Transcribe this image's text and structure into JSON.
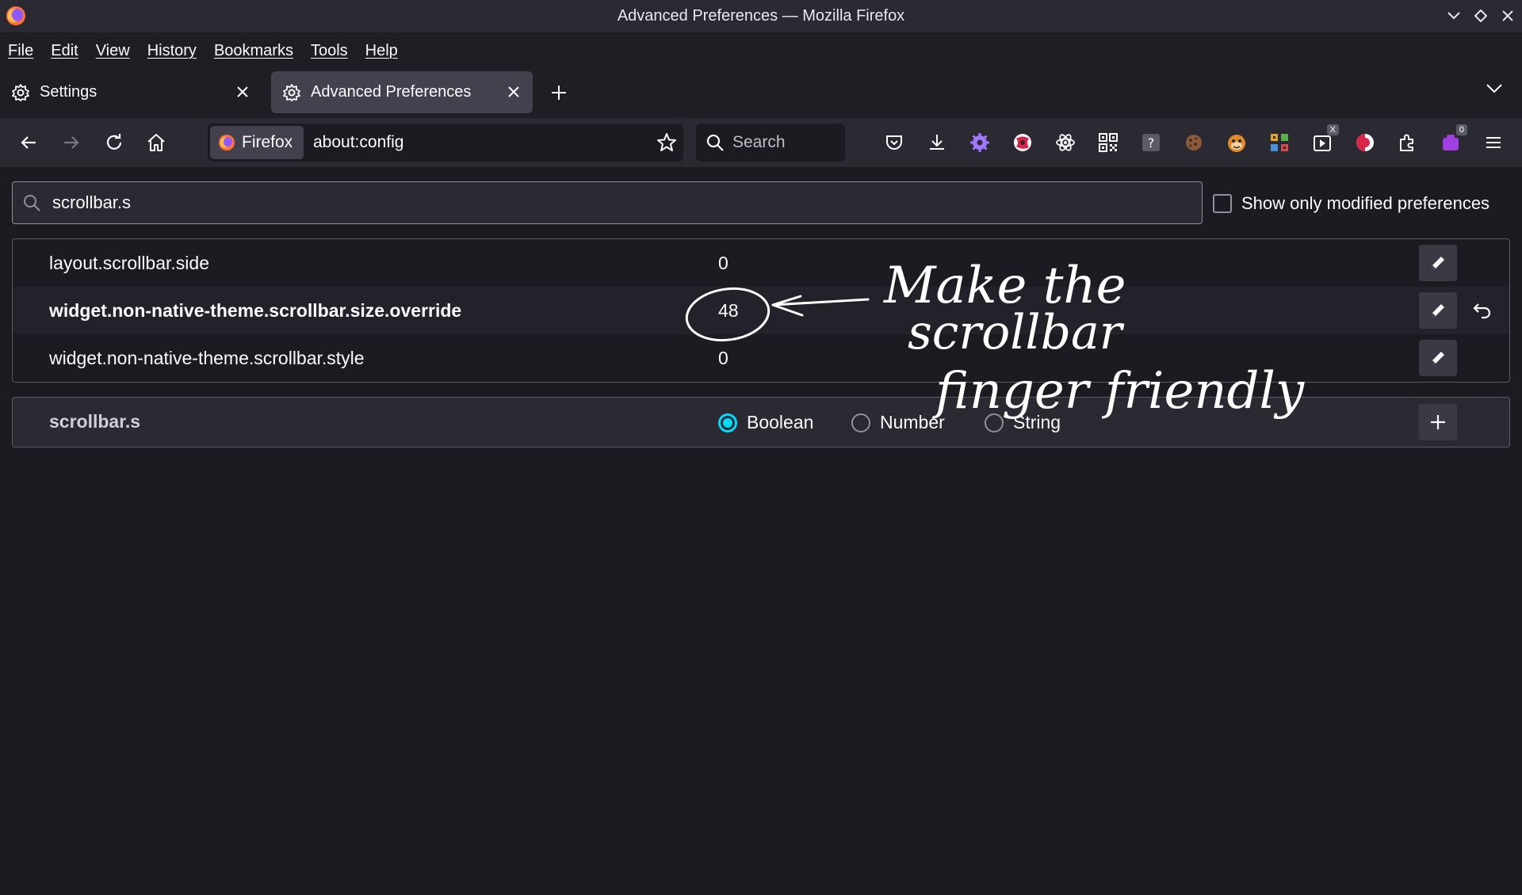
{
  "window": {
    "title": "Advanced Preferences — Mozilla Firefox"
  },
  "menu": [
    "File",
    "Edit",
    "View",
    "History",
    "Bookmarks",
    "Tools",
    "Help"
  ],
  "tabs": [
    {
      "label": "Settings",
      "icon": "gear-icon",
      "active": false
    },
    {
      "label": "Advanced Preferences",
      "icon": "gear-icon",
      "active": true
    }
  ],
  "navbar": {
    "identity_label": "Firefox",
    "url": "about:config",
    "search_placeholder": "Search"
  },
  "extensions": [
    {
      "icon": "pocket-icon"
    },
    {
      "icon": "download-icon"
    },
    {
      "icon": "purple-gear-icon"
    },
    {
      "icon": "privacy-badge-icon"
    },
    {
      "icon": "atom-icon"
    },
    {
      "icon": "qr-code-icon"
    },
    {
      "icon": "help-box-icon"
    },
    {
      "icon": "cookie-icon"
    },
    {
      "icon": "greasemonkey-icon"
    },
    {
      "icon": "grid-icon"
    },
    {
      "icon": "video-icon",
      "badge": "X"
    },
    {
      "icon": "red-half-icon"
    },
    {
      "icon": "extensions-puzzle-icon"
    },
    {
      "icon": "container-icon",
      "badge": "0"
    },
    {
      "icon": "hamburger-menu-icon"
    }
  ],
  "config": {
    "search_value": "scrollbar.s",
    "show_modified_label": "Show only modified preferences",
    "prefs": [
      {
        "name": "layout.scrollbar.side",
        "value": "0",
        "modified": false
      },
      {
        "name": "widget.non-native-theme.scrollbar.size.override",
        "value": "48",
        "modified": true
      },
      {
        "name": "widget.non-native-theme.scrollbar.style",
        "value": "0",
        "modified": false
      }
    ],
    "new_pref": {
      "name": "scrollbar.s",
      "types": [
        "Boolean",
        "Number",
        "String"
      ],
      "selected": "Boolean"
    }
  },
  "annotation": {
    "lines": [
      "Make the",
      "scrollbar",
      "finger friendly"
    ]
  },
  "colors": {
    "background": "#1c1b22",
    "toolbar": "#2b2a33",
    "accent": "#00ddff"
  }
}
